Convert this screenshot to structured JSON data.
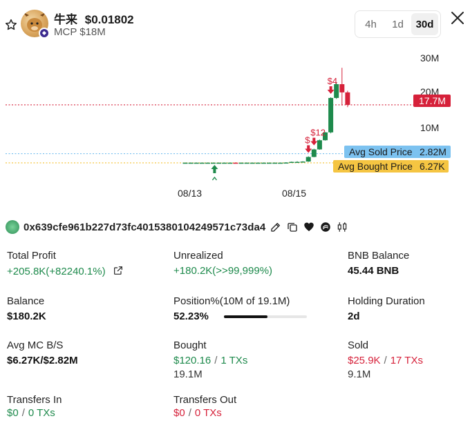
{
  "token": {
    "name": "牛来",
    "price": "$0.01802",
    "mcp": "MCP $18M"
  },
  "timeframes": [
    {
      "label": "4h",
      "active": false
    },
    {
      "label": "1d",
      "active": false
    },
    {
      "label": "30d",
      "active": true
    }
  ],
  "chart_data": {
    "type": "candlestick",
    "x_tick_labels": [
      "08/13",
      "08/15"
    ],
    "y_tick_labels": [
      "30M",
      "20M",
      "10M"
    ],
    "ylim": [
      0,
      32
    ],
    "price_line": {
      "label": "17.7M",
      "value": 17.7,
      "color": "#d6213a"
    },
    "avg_sold": {
      "label": "Avg Sold Price",
      "value_label": "2.82M",
      "value": 2.82,
      "color": "#7cc2f0"
    },
    "avg_bought": {
      "label": "Avg Bought Price",
      "value_label": "6.27K",
      "value": 0.00627,
      "color": "#f5c542"
    },
    "candles": [
      {
        "o": 0.0,
        "h": 0.1,
        "l": 0.0,
        "c": 0.05
      },
      {
        "o": 0.05,
        "h": 0.1,
        "l": 0.0,
        "c": 0.05
      },
      {
        "o": 0.05,
        "h": 0.1,
        "l": 0.0,
        "c": 0.05
      },
      {
        "o": 0.05,
        "h": 0.1,
        "l": 0.0,
        "c": 0.05
      },
      {
        "o": 0.05,
        "h": 0.1,
        "l": 0.0,
        "c": 0.05
      },
      {
        "o": 0.05,
        "h": 0.1,
        "l": 0.0,
        "c": 0.05
      },
      {
        "o": 0.05,
        "h": 0.1,
        "l": 0.0,
        "c": 0.05
      },
      {
        "o": 0.05,
        "h": 0.1,
        "l": 0.0,
        "c": 0.05
      },
      {
        "o": 0.05,
        "h": 0.1,
        "l": 0.0,
        "c": 0.05
      },
      {
        "o": 0.05,
        "h": 0.15,
        "l": 0.0,
        "c": 0.0
      },
      {
        "o": 0.0,
        "h": 0.1,
        "l": 0.0,
        "c": 0.05
      },
      {
        "o": 0.05,
        "h": 0.1,
        "l": 0.0,
        "c": 0.05
      },
      {
        "o": 0.05,
        "h": 0.1,
        "l": 0.0,
        "c": 0.05
      },
      {
        "o": 0.05,
        "h": 0.1,
        "l": 0.0,
        "c": 0.05
      },
      {
        "o": 0.05,
        "h": 0.1,
        "l": 0.0,
        "c": 0.05
      },
      {
        "o": 0.05,
        "h": 0.1,
        "l": 0.0,
        "c": 0.05
      },
      {
        "o": 0.05,
        "h": 0.1,
        "l": 0.0,
        "c": 0.05
      },
      {
        "o": 0.05,
        "h": 0.1,
        "l": 0.0,
        "c": 0.05
      },
      {
        "o": 0.05,
        "h": 0.2,
        "l": 0.0,
        "c": 0.1
      },
      {
        "o": 0.1,
        "h": 0.4,
        "l": 0.0,
        "c": 0.3
      },
      {
        "o": 0.3,
        "h": 0.5,
        "l": 0.1,
        "c": 0.3
      },
      {
        "o": 0.3,
        "h": 0.5,
        "l": 0.1,
        "c": 0.4
      },
      {
        "o": 0.4,
        "h": 2.0,
        "l": 0.3,
        "c": 1.8
      },
      {
        "o": 1.8,
        "h": 4.3,
        "l": 1.7,
        "c": 4.1
      },
      {
        "o": 4.1,
        "h": 7.1,
        "l": 4.0,
        "c": 6.9
      },
      {
        "o": 6.9,
        "h": 9.4,
        "l": 6.8,
        "c": 9.3
      },
      {
        "o": 9.3,
        "h": 20.0,
        "l": 9.0,
        "c": 19.8
      },
      {
        "o": 19.8,
        "h": 24.5,
        "l": 19.5,
        "c": 24.0
      },
      {
        "o": 24.0,
        "h": 29.0,
        "l": 17.5,
        "c": 21.5
      },
      {
        "o": 21.5,
        "h": 22.0,
        "l": 17.0,
        "c": 17.7
      }
    ],
    "buy_markers": [
      {
        "candle": 4
      }
    ],
    "sell_markers": [
      {
        "candle": 22,
        "label": "$"
      },
      {
        "candle": 23,
        "label": "$12"
      },
      {
        "candle": 26,
        "label": "$4"
      }
    ]
  },
  "wallet": {
    "address": "0x639cfe961b227d73fc4015380104249571c73da4"
  },
  "stats": {
    "total_profit_label": "Total Profit",
    "total_profit_value": "+205.8K(+82240.1%)",
    "unrealized_label": "Unrealized",
    "unrealized_value": "+180.2K(>>99,999%)",
    "bnb_balance_label": "BNB Balance",
    "bnb_balance_value": "45.44 BNB",
    "balance_label": "Balance",
    "balance_value": "$180.2K",
    "position_label": "Position%(10M of 19.1M)",
    "position_value": "52.23%",
    "position_fraction": 0.5223,
    "holding_label": "Holding Duration",
    "holding_value": "2d",
    "avg_mc_label": "Avg MC B/S",
    "avg_mc_value": "$6.27K/$2.82M",
    "bought_label": "Bought",
    "bought_amount": "$120.16",
    "bought_txs": "1 TXs",
    "bought_tokens": "19.1M",
    "sold_label": "Sold",
    "sold_amount": "$25.9K",
    "sold_txs": "17 TXs",
    "sold_tokens": "9.1M",
    "transfers_in_label": "Transfers In",
    "transfers_in_amount": "$0",
    "transfers_in_txs": "0 TXs",
    "transfers_out_label": "Transfers Out",
    "transfers_out_amount": "$0",
    "transfers_out_txs": "0 TXs",
    "slash": "/"
  }
}
